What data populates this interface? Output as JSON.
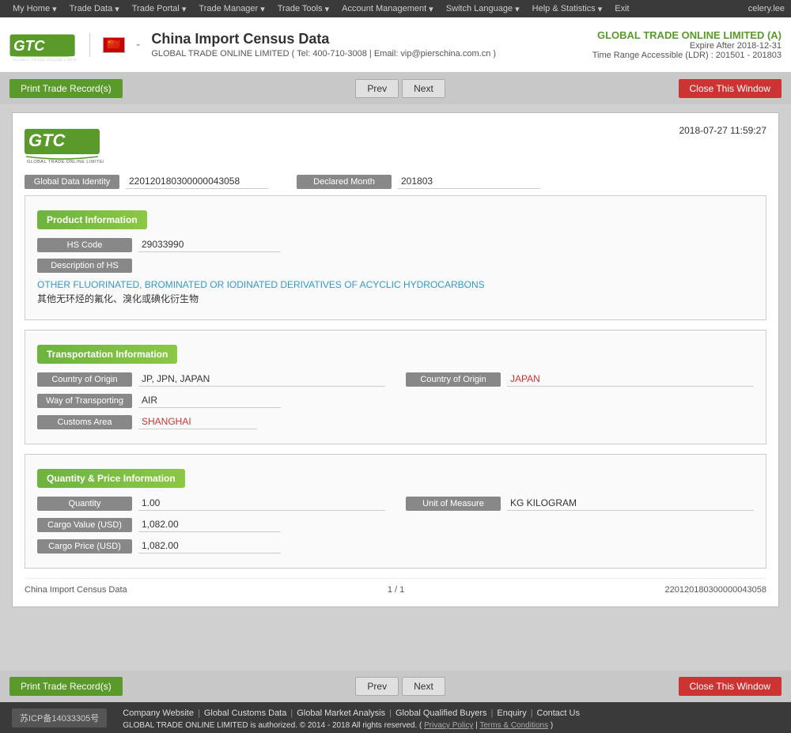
{
  "topNav": {
    "items": [
      "My Home",
      "Trade Data",
      "Trade Portal",
      "Trade Manager",
      "Trade Tools",
      "Account Management",
      "Switch Language",
      "Help & Statistics",
      "Exit"
    ],
    "user": "celery.lee"
  },
  "header": {
    "title": "China Import Census Data",
    "dash": "-",
    "company": "GLOBAL TRADE ONLINE LIMITED",
    "tel": "Tel: 400-710-3008",
    "email": "Email: vip@pierschina.com.cn",
    "rightCompany": "GLOBAL TRADE ONLINE LIMITED (A)",
    "expire": "Expire After 2018-12-31",
    "range": "Time Range Accessible (LDR) : 201501 - 201803"
  },
  "buttons": {
    "print": "Print Trade Record(s)",
    "prev": "Prev",
    "next": "Next",
    "closeWindow": "Close This Window"
  },
  "record": {
    "timestamp": "2018-07-27 11:59:27",
    "globalDataIdentity": {
      "label": "Global Data Identity",
      "value": "220120180300000043058"
    },
    "declaredMonth": {
      "label": "Declared Month",
      "value": "201803"
    },
    "productInfo": {
      "title": "Product Information",
      "hsCode": {
        "label": "HS Code",
        "value": "29033990"
      },
      "descriptionOfHS": {
        "label": "Description of HS"
      },
      "descEn": "OTHER FLUORINATED, BROMINATED OR IODINATED DERIVATIVES OF ACYCLIC HYDROCARBONS",
      "descCn": "其他无环烃的氟化、溴化或碘化衍生物"
    },
    "transportInfo": {
      "title": "Transportation Information",
      "countryOfOriginCode": {
        "label": "Country of Origin",
        "value": "JP, JPN, JAPAN"
      },
      "countryOfOriginName": {
        "label": "Country of Origin",
        "value": "JAPAN"
      },
      "wayOfTransporting": {
        "label": "Way of Transporting",
        "value": "AIR"
      },
      "customsArea": {
        "label": "Customs Area",
        "value": "SHANGHAI"
      }
    },
    "quantityPrice": {
      "title": "Quantity & Price Information",
      "quantity": {
        "label": "Quantity",
        "value": "1.00"
      },
      "unitOfMeasure": {
        "label": "Unit of Measure",
        "value": "KG KILOGRAM"
      },
      "cargoValueUSD": {
        "label": "Cargo Value (USD)",
        "value": "1,082.00"
      },
      "cargoPriceUSD": {
        "label": "Cargo Price (USD)",
        "value": "1,082.00"
      }
    },
    "footer": {
      "left": "China Import Census Data",
      "center": "1 / 1",
      "right": "220120180300000043058"
    }
  },
  "footerLinks": {
    "items": [
      "Company Website",
      "Global Customs Data",
      "Global Market Analysis",
      "Global Qualified Buyers",
      "Enquiry",
      "Contact Us"
    ],
    "copyright": "GLOBAL TRADE ONLINE LIMITED is authorized. © 2014 - 2018 All rights reserved.",
    "privacy": "Privacy Policy",
    "terms": "Terms & Conditions",
    "icp": "苏ICP备14033305号"
  }
}
